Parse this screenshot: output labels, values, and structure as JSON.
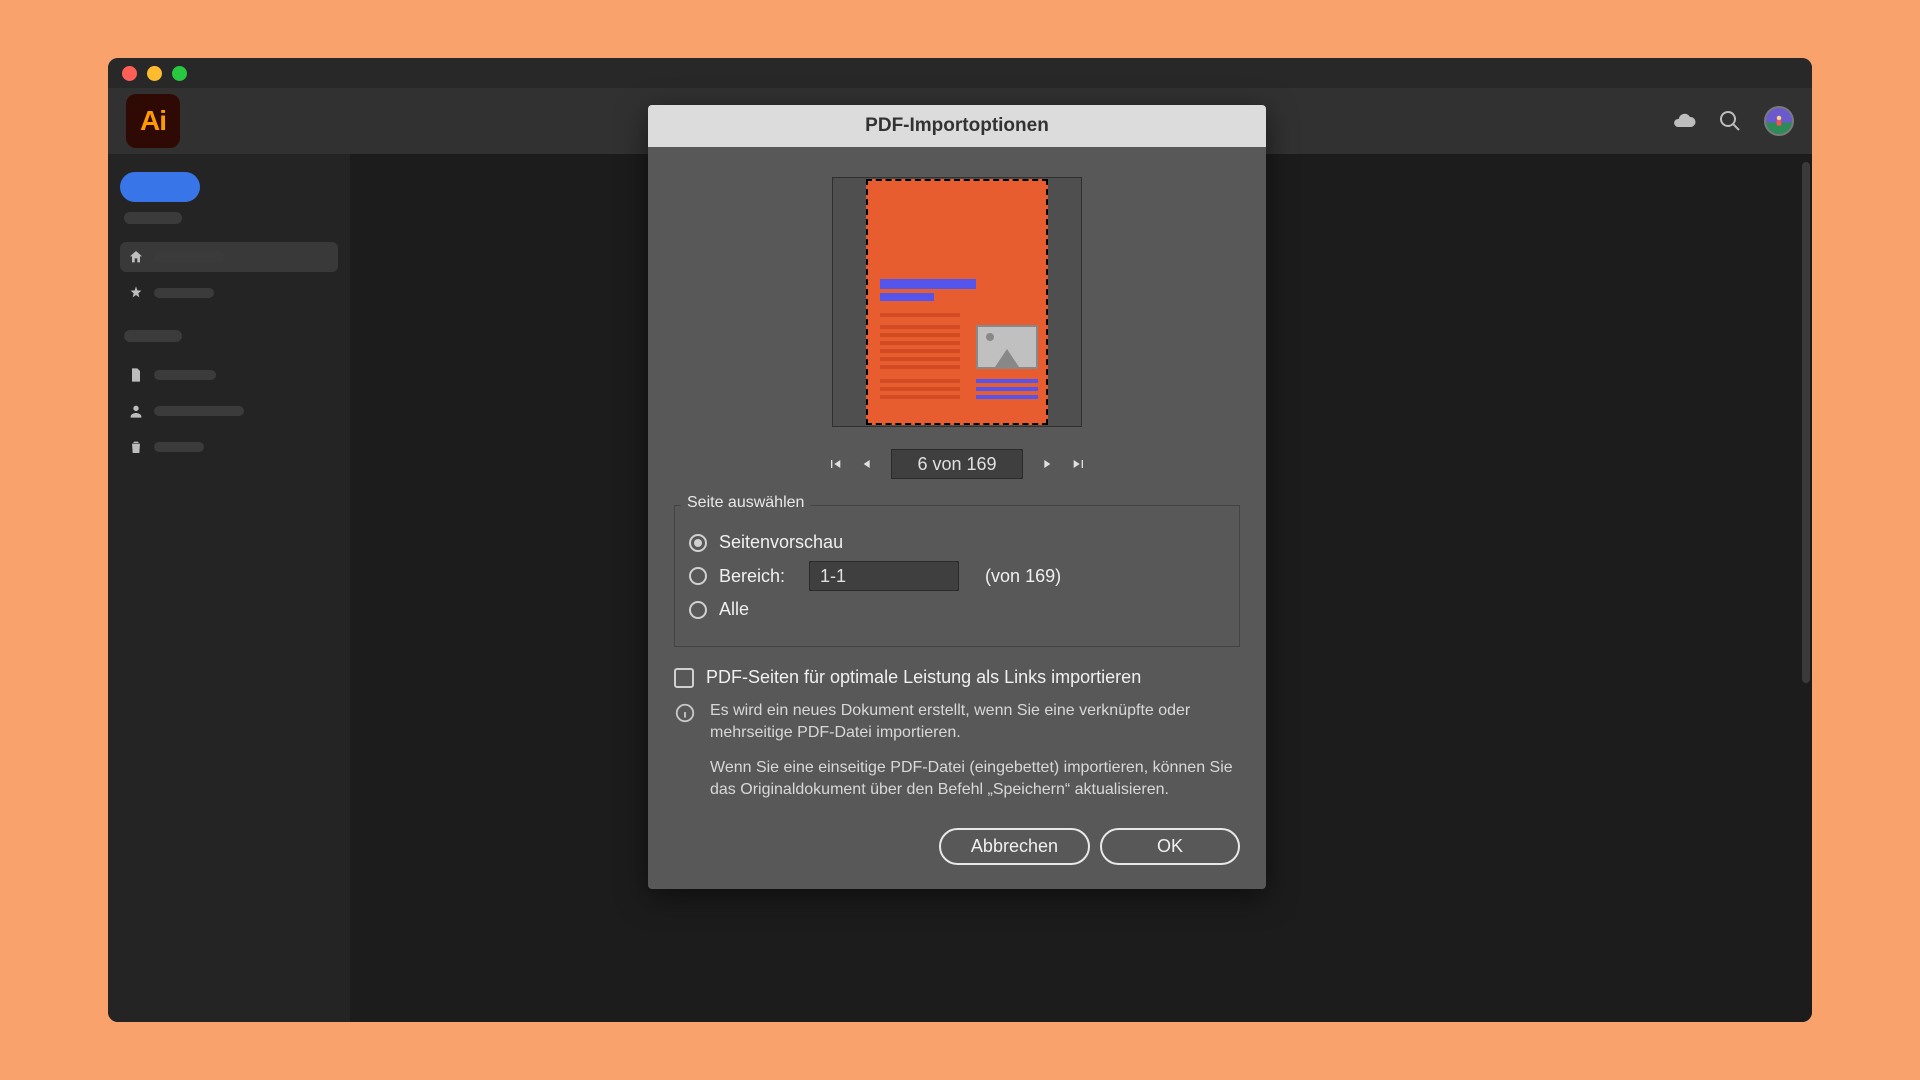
{
  "modal": {
    "title": "PDF-Importoptionen",
    "pager": {
      "value": "6 von 169"
    },
    "section_label": "Seite auswählen",
    "radio": {
      "preview": "Seitenvorschau",
      "range_label": "Bereich:",
      "range_value": "1-1",
      "range_of": "(von 169)",
      "all": "Alle"
    },
    "checkbox": "PDF-Seiten für optimale Leistung als Links importieren",
    "info1": "Es wird ein neues Dokument erstellt, wenn Sie eine verknüpfte oder mehrseitige PDF-Datei importieren.",
    "info2": "Wenn Sie eine einseitige PDF-Datei (eingebettet) importieren, können Sie das Originaldokument über den Befehl „Speichern“ aktualisieren.",
    "cancel": "Abbrechen",
    "ok": "OK"
  },
  "app_logo": "Ai"
}
